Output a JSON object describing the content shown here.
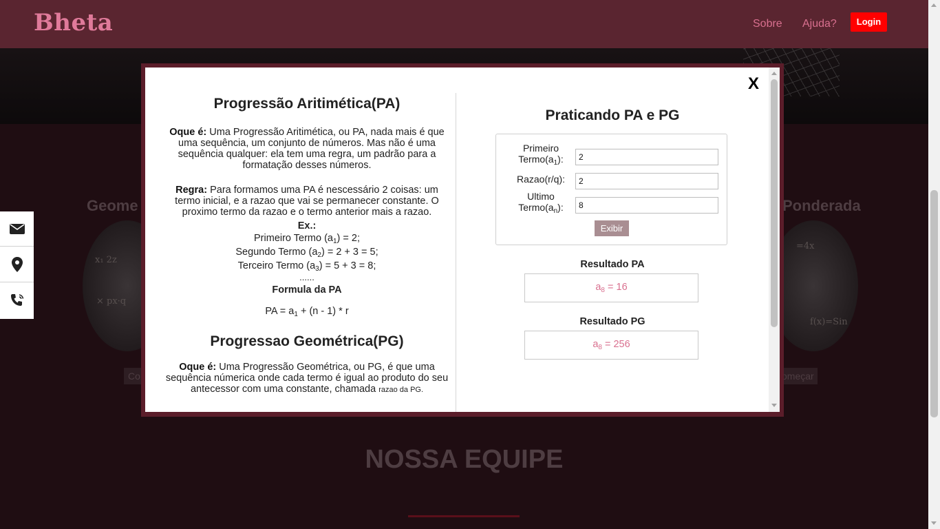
{
  "navbar": {
    "brand": "Bheta",
    "links": [
      "Sobre",
      "Ajuda?"
    ],
    "login": "Login"
  },
  "background": {
    "heading_left": "Geome",
    "heading_right": "Ponderada",
    "button_left": "Co",
    "button_right": "omeçar",
    "section_title": "NOSSA EQUIPE"
  },
  "sidebar": {
    "icons": [
      "envelope-icon",
      "map-marker-icon",
      "phone-icon"
    ]
  },
  "modal": {
    "close": "X",
    "pa": {
      "title": "Progressão Aritimética(PA)",
      "oque_label": "Oque é:",
      "oque_text": "Uma Progressão Aritimética, ou PA, nada mais é que uma sequência, um conjunto de números. Mas não é uma sequência qualquer: ela tem uma regra, um padrão para a formatação desses números.",
      "regra_label": "Regra:",
      "regra_text": "Para formamos uma PA é nescessário 2 coisas: um termo inicial, e a razao que vai se permanecer constante. O proximo termo da razao e o termo anterior mais a razao.",
      "ex_title": "Ex.:",
      "ex1_pre": "Primeiro Termo  (a",
      "ex1_sub": "1",
      "ex1_post": ") = 2;",
      "ex2_pre": "Segundo Termo (a",
      "ex2_sub": "2",
      "ex2_post": ") = 2 + 3 = 5;",
      "ex3_pre": "Terceiro Termo   (a",
      "ex3_sub": "3",
      "ex3_post": ") = 5 + 3 = 8;",
      "dots": "......",
      "formula_title": "Formula da PA",
      "formula_pre": "PA = a",
      "formula_sub": "1",
      "formula_post": " + (n - 1) * r"
    },
    "pg": {
      "title": "Progressao Geométrica(PG)",
      "oque_label": "Oque é:",
      "oque_text": "Uma Progressão Geométrica, ou PG, é que uma sequência númerica onde cada termo é igual ao produto do seu antecessor com uma constante, chamada",
      "oque_tail": "razao da PG."
    },
    "practice": {
      "title": "Praticando PA e PG",
      "label_first_line1": "Primeiro",
      "label_first_line2": "Termo(a",
      "label_first_sub": "1",
      "label_first_end": "):",
      "first_value": "2",
      "label_razao": "Razao(r/q):",
      "razao_value": "2",
      "label_last_line1": "Ultimo",
      "label_last_line2": "Termo(a",
      "label_last_sub": "n",
      "label_last_end": "):",
      "last_value": "8",
      "button": "Exibir",
      "result_pa_label": "Resultado PA",
      "result_pa_pre": "a",
      "result_pa_sub": "8",
      "result_pa_post": " = 16",
      "result_pg_label": "Resultado PG",
      "result_pg_pre": "a",
      "result_pg_sub": "8",
      "result_pg_post": " = 256"
    }
  }
}
